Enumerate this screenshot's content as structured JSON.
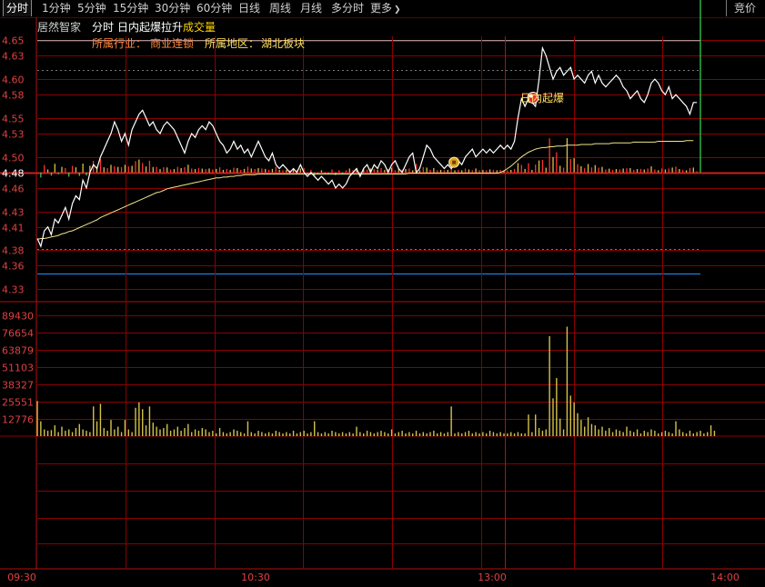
{
  "toolbar": {
    "tabs": [
      {
        "label": "分时",
        "active": true
      },
      {
        "label": "1分钟"
      },
      {
        "label": "5分钟"
      },
      {
        "label": "15分钟"
      },
      {
        "label": "30分钟"
      },
      {
        "label": "60分钟"
      },
      {
        "label": "日线"
      },
      {
        "label": "周线"
      },
      {
        "label": "月线"
      },
      {
        "label": "多分时"
      },
      {
        "label": "更多"
      }
    ],
    "more_arrow": "❯",
    "right_tab": "竞价"
  },
  "header": {
    "stock_name": "居然智家",
    "chart_mode": "分时",
    "signal_name": "日内起爆拉升",
    "volume_label": "成交量",
    "industry_label": "所属行业：",
    "industry_value": "商业连锁",
    "region_label": "所属地区：",
    "region_value": "湖北板块"
  },
  "annotations": {
    "burst_label": "日内起爆"
  },
  "colors": {
    "background": "#000000",
    "grid": "#8b0000",
    "grid_bright": "#b01010",
    "price_line": "#ffffff",
    "avg_line": "#f0e68c",
    "up_bar": "#ff3333",
    "down_bar": "#33cc55",
    "volume_bar": "#d4c24a",
    "price_axis_text": "#e04040",
    "base_line": "#cc2020",
    "support_line": "#1e90ff",
    "industry_text": "#ff8a3d",
    "header_signal": "#ffffff",
    "header_volume": "#ffd700"
  },
  "chart_data": [
    {
      "type": "line",
      "name": "price",
      "x_ticks": [
        "09:30",
        "10:30",
        "13:00",
        "14:00"
      ],
      "y_ticks": [
        4.65,
        4.63,
        4.6,
        4.58,
        4.55,
        4.53,
        4.5,
        4.48,
        4.46,
        4.43,
        4.41,
        4.38,
        4.36,
        4.33
      ],
      "ylim": [
        4.315,
        4.655
      ],
      "prev_close": 4.48,
      "support_level": 4.35,
      "dashed_levels": [
        4.612,
        4.382
      ],
      "x_count": 190,
      "series": [
        {
          "name": "price",
          "values": [
            4.395,
            4.385,
            4.405,
            4.41,
            4.4,
            4.42,
            4.415,
            4.425,
            4.435,
            4.42,
            4.44,
            4.45,
            4.445,
            4.47,
            4.46,
            4.48,
            4.49,
            4.485,
            4.5,
            4.51,
            4.52,
            4.53,
            4.545,
            4.535,
            4.52,
            4.53,
            4.515,
            4.535,
            4.545,
            4.555,
            4.56,
            4.55,
            4.54,
            4.545,
            4.535,
            4.53,
            4.54,
            4.545,
            4.54,
            4.535,
            4.525,
            4.515,
            4.505,
            4.52,
            4.53,
            4.525,
            4.535,
            4.54,
            4.535,
            4.545,
            4.54,
            4.53,
            4.52,
            4.515,
            4.505,
            4.51,
            4.52,
            4.51,
            4.515,
            4.505,
            4.51,
            4.5,
            4.51,
            4.52,
            4.51,
            4.5,
            4.495,
            4.505,
            4.49,
            4.485,
            4.49,
            4.485,
            4.48,
            4.485,
            4.48,
            4.49,
            4.48,
            4.475,
            4.48,
            4.475,
            4.47,
            4.475,
            4.47,
            4.465,
            4.47,
            4.46,
            4.465,
            4.46,
            4.465,
            4.475,
            4.48,
            4.485,
            4.475,
            4.485,
            4.49,
            4.48,
            4.49,
            4.485,
            4.495,
            4.49,
            4.48,
            4.49,
            4.495,
            4.485,
            4.48,
            4.49,
            4.5,
            4.505,
            4.48,
            4.485,
            4.5,
            4.515,
            4.51,
            4.5,
            4.495,
            4.49,
            4.485,
            4.49,
            4.485,
            4.49,
            4.495,
            4.49,
            4.5,
            4.505,
            4.51,
            4.5,
            4.505,
            4.51,
            4.505,
            4.51,
            4.505,
            4.51,
            4.515,
            4.51,
            4.515,
            4.51,
            4.52,
            4.55,
            4.575,
            4.565,
            4.575,
            4.57,
            4.565,
            4.6,
            4.64,
            4.63,
            4.615,
            4.6,
            4.61,
            4.615,
            4.605,
            4.61,
            4.615,
            4.6,
            4.605,
            4.6,
            4.595,
            4.605,
            4.61,
            4.595,
            4.605,
            4.595,
            4.59,
            4.595,
            4.6,
            4.605,
            4.6,
            4.59,
            4.585,
            4.575,
            4.58,
            4.585,
            4.575,
            4.57,
            4.58,
            4.595,
            4.6,
            4.595,
            4.585,
            4.58,
            4.59,
            4.575,
            4.58,
            4.575,
            4.57,
            4.565,
            4.555,
            4.57,
            4.57
          ]
        },
        {
          "name": "average",
          "values": [
            4.394,
            4.395,
            4.395,
            4.396,
            4.397,
            4.398,
            4.399,
            4.401,
            4.402,
            4.404,
            4.405,
            4.407,
            4.409,
            4.411,
            4.413,
            4.415,
            4.417,
            4.419,
            4.422,
            4.424,
            4.426,
            4.428,
            4.43,
            4.432,
            4.434,
            4.436,
            4.438,
            4.44,
            4.442,
            4.444,
            4.446,
            4.448,
            4.45,
            4.452,
            4.454,
            4.455,
            4.457,
            4.459,
            4.46,
            4.461,
            4.462,
            4.463,
            4.464,
            4.465,
            4.466,
            4.467,
            4.468,
            4.469,
            4.47,
            4.471,
            4.472,
            4.473,
            4.473,
            4.474,
            4.474,
            4.475,
            4.475,
            4.476,
            4.476,
            4.477,
            4.477,
            4.477,
            4.477,
            4.478,
            4.478,
            4.478,
            4.478,
            4.478,
            4.478,
            4.478,
            4.478,
            4.478,
            4.478,
            4.478,
            4.478,
            4.478,
            4.478,
            4.478,
            4.478,
            4.478,
            4.478,
            4.478,
            4.478,
            4.478,
            4.478,
            4.478,
            4.478,
            4.478,
            4.478,
            4.478,
            4.478,
            4.478,
            4.478,
            4.478,
            4.478,
            4.478,
            4.478,
            4.478,
            4.478,
            4.478,
            4.478,
            4.478,
            4.478,
            4.478,
            4.478,
            4.478,
            4.479,
            4.479,
            4.479,
            4.479,
            4.479,
            4.479,
            4.479,
            4.479,
            4.479,
            4.479,
            4.479,
            4.479,
            4.479,
            4.479,
            4.479,
            4.479,
            4.479,
            4.479,
            4.479,
            4.479,
            4.479,
            4.479,
            4.479,
            4.479,
            4.479,
            4.479,
            4.48,
            4.482,
            4.485,
            4.488,
            4.492,
            4.496,
            4.5,
            4.503,
            4.506,
            4.508,
            4.51,
            4.511,
            4.512,
            4.512,
            4.513,
            4.513,
            4.514,
            4.514,
            4.514,
            4.515,
            4.515,
            4.515,
            4.515,
            4.516,
            4.516,
            4.516,
            4.516,
            4.517,
            4.517,
            4.517,
            4.517,
            4.517,
            4.518,
            4.518,
            4.518,
            4.518,
            4.518,
            4.518,
            4.519,
            4.519,
            4.519,
            4.519,
            4.519,
            4.519,
            4.519,
            4.52,
            4.52,
            4.52,
            4.52,
            4.52,
            4.52,
            4.52,
            4.52,
            4.521,
            4.521,
            4.521
          ]
        }
      ],
      "markers": [
        {
          "type": "burst",
          "index": 140,
          "price": 4.575
        },
        {
          "type": "money-bag",
          "index": 118,
          "price": 4.493
        }
      ]
    },
    {
      "type": "bar",
      "name": "volume",
      "y_ticks": [
        89430,
        76654,
        63879,
        51103,
        38327,
        25551,
        12776
      ],
      "ylim": [
        0,
        89430
      ],
      "values": [
        26000,
        11000,
        5000,
        4000,
        4500,
        8000,
        3000,
        7000,
        4000,
        5000,
        3000,
        6000,
        9000,
        5000,
        4000,
        3000,
        22000,
        11000,
        24000,
        6000,
        4000,
        12000,
        5000,
        7000,
        3000,
        12000,
        5000,
        3000,
        21000,
        25000,
        20000,
        8000,
        22000,
        10000,
        7000,
        5000,
        6000,
        9000,
        4000,
        5000,
        7000,
        4000,
        6000,
        9000,
        3000,
        5000,
        4000,
        6000,
        5000,
        3000,
        4000,
        2000,
        6000,
        3000,
        2000,
        3000,
        5000,
        4000,
        3000,
        2000,
        11000,
        3000,
        2000,
        4000,
        3000,
        2000,
        3000,
        2000,
        4000,
        3000,
        2000,
        3000,
        2000,
        4000,
        2000,
        3000,
        4000,
        2000,
        3000,
        11000,
        3000,
        2000,
        3000,
        2000,
        4000,
        3000,
        2000,
        3000,
        2000,
        3000,
        2000,
        7000,
        3000,
        2000,
        4000,
        3000,
        2000,
        3000,
        4000,
        3000,
        2000,
        5000,
        2000,
        3000,
        4000,
        2000,
        3000,
        2000,
        4000,
        2000,
        3000,
        2000,
        3000,
        4000,
        2000,
        3000,
        2000,
        3000,
        22000,
        2000,
        3000,
        2000,
        3000,
        4000,
        2000,
        3000,
        2000,
        3000,
        2000,
        4000,
        3000,
        2000,
        3000,
        2000,
        2000,
        3000,
        2000,
        3000,
        2000,
        2000,
        16000,
        3000,
        16000,
        6000,
        4000,
        5000,
        74000,
        28000,
        43000,
        13000,
        5000,
        81000,
        30000,
        25000,
        17000,
        12000,
        7000,
        14000,
        9000,
        8000,
        5000,
        7000,
        4000,
        6000,
        3000,
        5000,
        4000,
        3000,
        7000,
        4000,
        3000,
        5000,
        2000,
        4000,
        3000,
        5000,
        4000,
        2000,
        3000,
        4000,
        3000,
        2000,
        11000,
        5000,
        3000,
        2000,
        4000,
        2000,
        3000,
        4000,
        2000,
        3000,
        8000,
        4000
      ]
    }
  ]
}
